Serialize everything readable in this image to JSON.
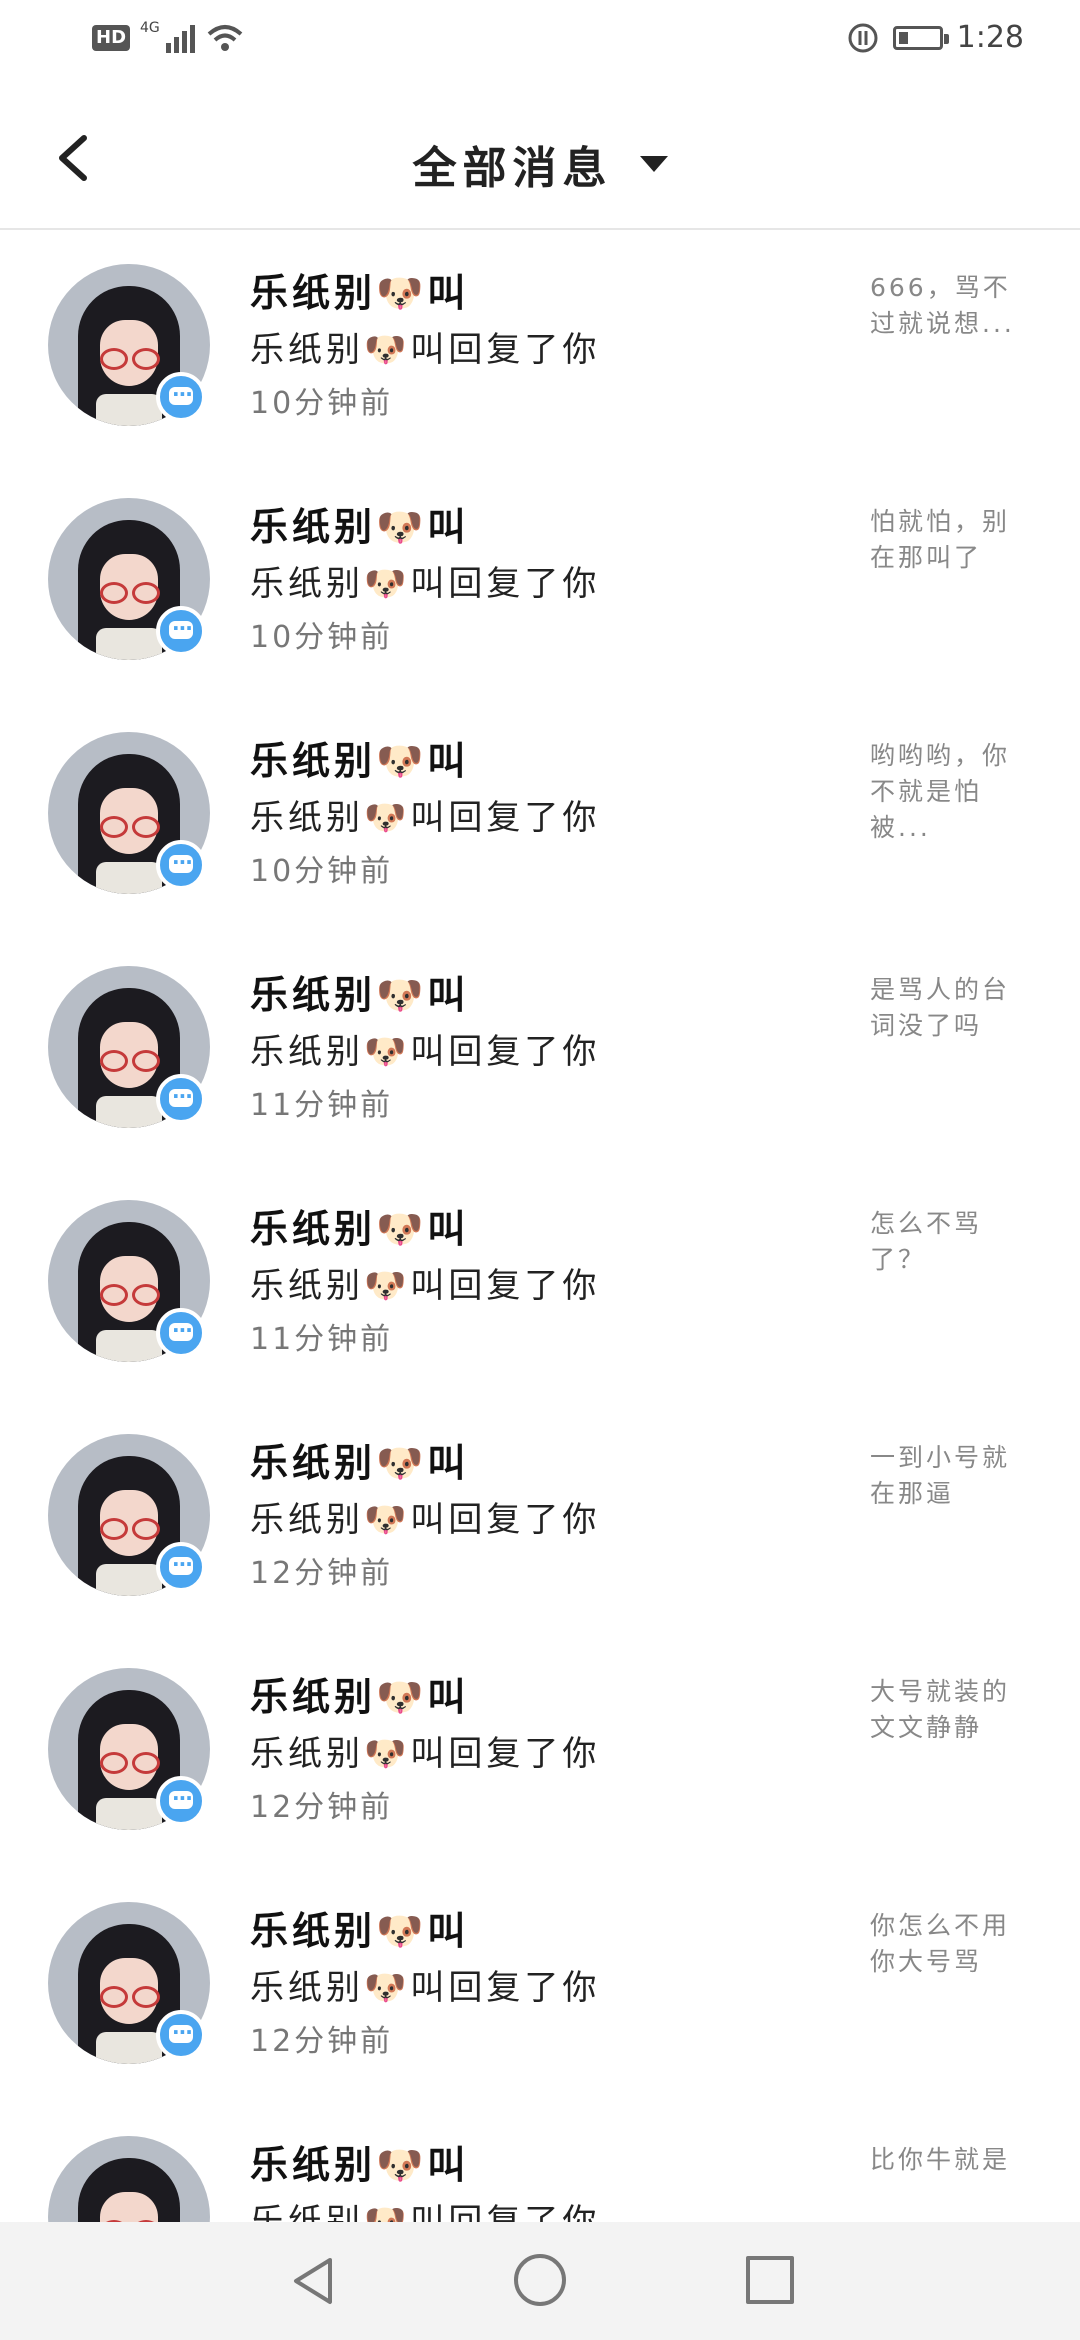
{
  "status_bar": {
    "hd": "HD",
    "network": "4G",
    "time": "1:28"
  },
  "header": {
    "title": "全部消息"
  },
  "messages": [
    {
      "name": "乐纸别🐶叫",
      "action": "乐纸别🐶叫回复了你",
      "time": "10分钟前",
      "preview": "666，骂不过就说想..."
    },
    {
      "name": "乐纸别🐶叫",
      "action": "乐纸别🐶叫回复了你",
      "time": "10分钟前",
      "preview": "怕就怕，别在那叫了"
    },
    {
      "name": "乐纸别🐶叫",
      "action": "乐纸别🐶叫回复了你",
      "time": "10分钟前",
      "preview": "哟哟哟，你不就是怕被..."
    },
    {
      "name": "乐纸别🐶叫",
      "action": "乐纸别🐶叫回复了你",
      "time": "11分钟前",
      "preview": "是骂人的台词没了吗"
    },
    {
      "name": "乐纸别🐶叫",
      "action": "乐纸别🐶叫回复了你",
      "time": "11分钟前",
      "preview": "怎么不骂了？"
    },
    {
      "name": "乐纸别🐶叫",
      "action": "乐纸别🐶叫回复了你",
      "time": "12分钟前",
      "preview": "一到小号就在那逼"
    },
    {
      "name": "乐纸别🐶叫",
      "action": "乐纸别🐶叫回复了你",
      "time": "12分钟前",
      "preview": "大号就装的文文静静"
    },
    {
      "name": "乐纸别🐶叫",
      "action": "乐纸别🐶叫回复了你",
      "time": "12分钟前",
      "preview": "你怎么不用你大号骂"
    },
    {
      "name": "乐纸别🐶叫",
      "action": "乐纸别🐶叫回复了你",
      "time": "",
      "preview": "比你牛就是"
    }
  ]
}
